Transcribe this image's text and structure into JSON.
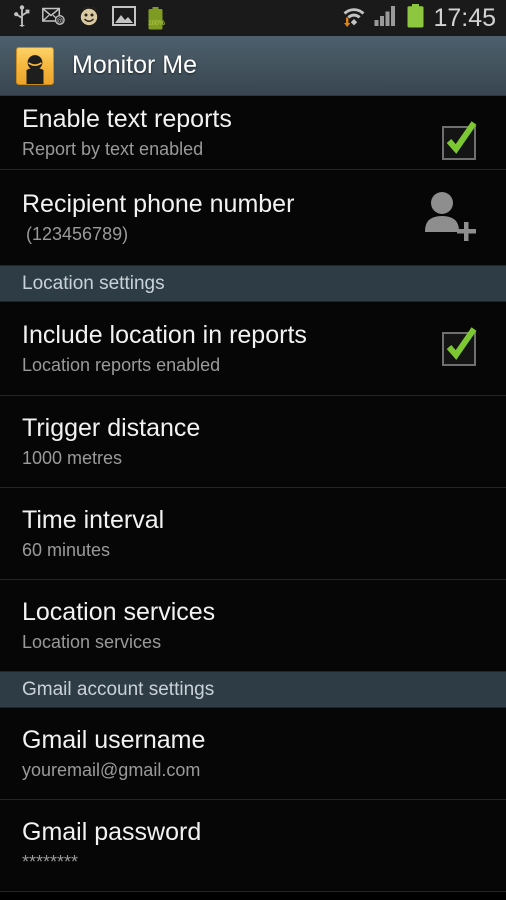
{
  "status_bar": {
    "left_icons": [
      "usb-icon",
      "email-icon",
      "smiley-icon",
      "screenshot-image-icon",
      "battery-charge-icon"
    ],
    "battery_percent": "100%",
    "right_icons": [
      "wifi-transfer-icon",
      "cellular-signal-icon",
      "battery-icon"
    ],
    "clock": "17:45"
  },
  "action_bar": {
    "app_icon": "person-avatar-icon",
    "title": "Monitor Me"
  },
  "colors": {
    "accent_green": "#7dc832",
    "app_icon_orange": "#f6b83f",
    "action_bar": "#44545f",
    "section_header_bg": "#2e3c45",
    "list_bg": "#060606",
    "title_text": "#f2f2f2",
    "summary_text": "#9a9a9a"
  },
  "settings": [
    {
      "key": "enable_text_reports",
      "title": "Enable text reports",
      "summary": "Report by text enabled",
      "widget": "checkbox",
      "checked": true
    },
    {
      "key": "recipient_phone_number",
      "title": "Recipient phone number",
      "summary": "(123456789)",
      "widget": "add-contact-icon"
    }
  ],
  "section_location": {
    "header": "Location settings",
    "items": [
      {
        "key": "include_location_in_reports",
        "title": "Include location in reports",
        "summary": "Location reports enabled",
        "widget": "checkbox",
        "checked": true
      },
      {
        "key": "trigger_distance",
        "title": "Trigger distance",
        "summary": "1000 metres",
        "widget": "none"
      },
      {
        "key": "time_interval",
        "title": "Time interval",
        "summary": "60 minutes",
        "widget": "none"
      },
      {
        "key": "location_services",
        "title": "Location services",
        "summary": "Location services",
        "widget": "none"
      }
    ]
  },
  "section_gmail": {
    "header": "Gmail account settings",
    "items": [
      {
        "key": "gmail_username",
        "title": "Gmail username",
        "summary": "youremail@gmail.com",
        "widget": "none"
      },
      {
        "key": "gmail_password",
        "title": "Gmail password",
        "summary": "********",
        "widget": "none"
      }
    ]
  }
}
